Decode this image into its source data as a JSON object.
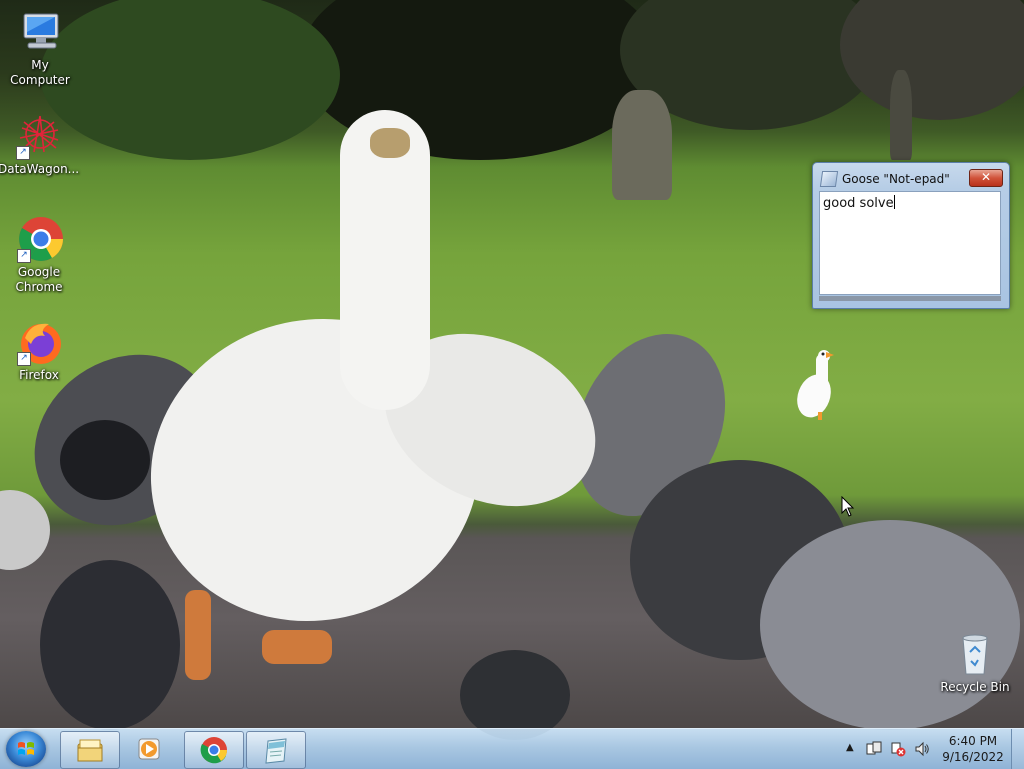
{
  "desktop": {
    "icons": [
      {
        "label": "My Computer",
        "icon": "computer-icon"
      },
      {
        "label": "DataWagon...",
        "icon": "datawagon-icon"
      },
      {
        "label": "Google Chrome",
        "icon": "chrome-icon"
      },
      {
        "label": "Firefox",
        "icon": "firefox-icon"
      },
      {
        "label": "Recycle Bin",
        "icon": "recycle-bin-icon"
      }
    ]
  },
  "notepad": {
    "title": "Goose \"Not-epad\"",
    "close_label": "✕",
    "text": "good solve"
  },
  "taskbar": {
    "pinned": [
      "start-orb-icon",
      "file-explorer-icon",
      "media-player-icon",
      "chrome-icon",
      "notepad-icon"
    ],
    "tray": {
      "show_hidden_label": "▲",
      "clock_time": "6:40 PM",
      "clock_date": "9/16/2022"
    }
  },
  "colors": {
    "taskbar": "#a9c7e2",
    "close_button": "#d0533a",
    "window_frame": "#b6cde6"
  }
}
